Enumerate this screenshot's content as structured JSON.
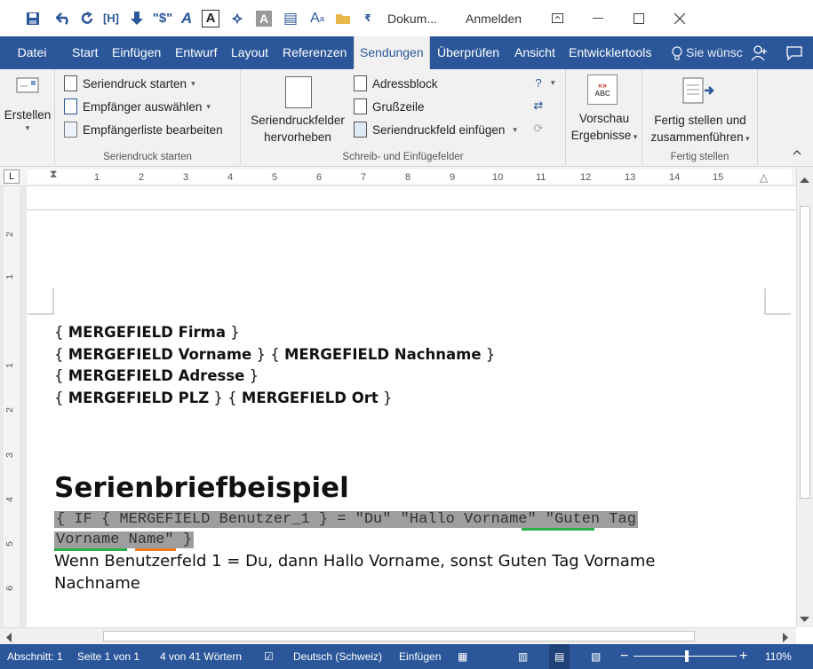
{
  "titlebar": {
    "doc_title": "Dokum...",
    "signin": "Anmelden",
    "quick_access": [
      "save-icon",
      "undo-icon",
      "redo-icon",
      "field-codes-icon",
      "macro-icon",
      "insert-field-icon",
      "format-icon",
      "text-box-icon",
      "paint-icon",
      "highlight-icon",
      "merge-icon",
      "superscript-icon",
      "open-folder-icon",
      "customize-icon"
    ]
  },
  "tabs": [
    {
      "label": "Datei"
    },
    {
      "label": "Start"
    },
    {
      "label": "Einfügen"
    },
    {
      "label": "Entwurf"
    },
    {
      "label": "Layout"
    },
    {
      "label": "Referenzen"
    },
    {
      "label": "Sendungen"
    },
    {
      "label": "Überprüfen"
    },
    {
      "label": "Ansicht"
    },
    {
      "label": "Entwicklertools"
    }
  ],
  "tell_me": "Sie wünsc",
  "ribbon": {
    "groups": {
      "erstellen": {
        "button": "Erstellen"
      },
      "seriendruck": {
        "label": "Seriendruck starten",
        "start": "Seriendruck starten",
        "empfaenger": "Empfänger auswählen",
        "liste": "Empfängerliste bearbeiten"
      },
      "felder": {
        "label": "Schreib- und Einfügefelder",
        "hervorheben_1": "Seriendruckfelder",
        "hervorheben_2": "hervorheben",
        "adressblock": "Adressblock",
        "grusszeile": "Grußzeile",
        "einfuegen": "Seriendruckfeld einfügen"
      },
      "vorschau": {
        "line1": "Vorschau",
        "line2": "Ergebnisse",
        "icon_text": "ABC"
      },
      "fertig": {
        "label": "Fertig stellen",
        "line1": "Fertig stellen und",
        "line2": "zusammenführen"
      }
    }
  },
  "ruler": {
    "numbers": [
      "1",
      "2",
      "3",
      "4",
      "5",
      "6",
      "7",
      "8",
      "9",
      "10",
      "11",
      "12",
      "13",
      "14",
      "15"
    ],
    "vertical": [
      "2",
      "1",
      "1",
      "2",
      "3",
      "4",
      "5",
      "6"
    ]
  },
  "document": {
    "lines": [
      {
        "open": "{ ",
        "text": "MERGEFIELD Firma",
        "close": " }"
      },
      {
        "open": "{ ",
        "text": "MERGEFIELD Vorname",
        "mid": " } { ",
        "text2": "MERGEFIELD Nachname",
        "close": " }"
      },
      {
        "open": "{ ",
        "text": "MERGEFIELD Adresse",
        "close": " }"
      },
      {
        "open": "{ ",
        "text": "MERGEFIELD PLZ",
        "mid": " } { ",
        "text2": "MERGEFIELD Ort",
        "close": " }"
      }
    ],
    "heading": "Serienbriefbeispiel",
    "code_line1": "{ IF { MERGEFIELD Benutzer_1 } = \"Du\" \"Hallo Vorname\" \"Guten Tag ",
    "code_line2": "Vorname Name\" }",
    "normal_line1": "Wenn Benutzerfeld 1 = Du, dann Hallo Vorname, sonst Guten Tag Vorname",
    "normal_line2": "Nachname"
  },
  "statusbar": {
    "section": "Abschnitt: 1",
    "page": "Seite 1 von 1",
    "words": "4 von 41 Wörtern",
    "language": "Deutsch (Schweiz)",
    "mode": "Einfügen",
    "zoom": "110%"
  },
  "colors": {
    "accent": "#2b579a",
    "ribbon_bg": "#f1f1f1",
    "field_shade": "#9e9e9e",
    "squiggle_green": "#2bb04a",
    "squiggle_orange": "#f07a22"
  }
}
